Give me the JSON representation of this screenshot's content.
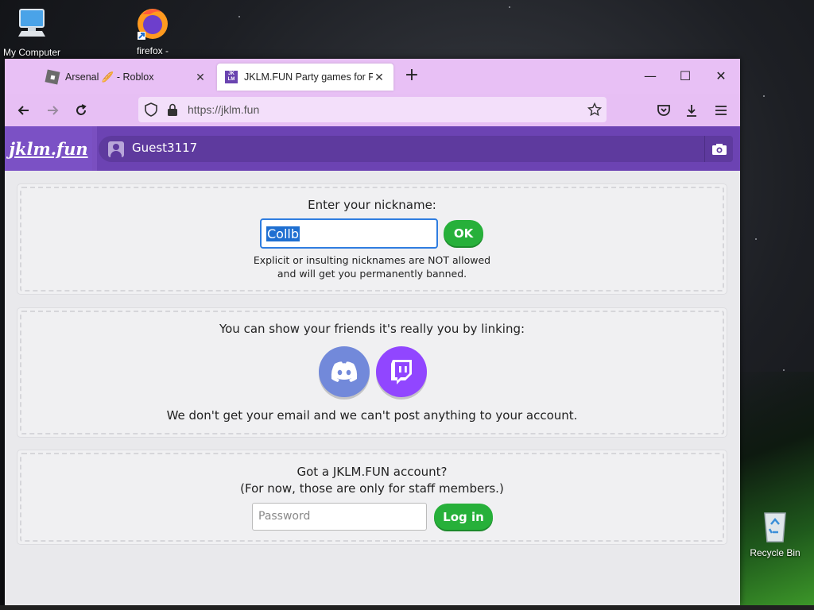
{
  "desktop": {
    "icons": [
      {
        "label": "My Computer"
      },
      {
        "label": "firefox -"
      },
      {
        "label": "Recycle Bin"
      }
    ]
  },
  "browser": {
    "tabs": [
      {
        "title": "Arsenal 🥖 - Roblox",
        "active": false
      },
      {
        "title": "JKLM.FUN Party games for PC &",
        "active": true
      }
    ],
    "url": "https://jklm.fun"
  },
  "site": {
    "logo": "jklm.fun",
    "username": "Guest3117",
    "nickname_panel": {
      "prompt": "Enter your nickname:",
      "value": "Collb",
      "ok_label": "OK",
      "warning_line1": "Explicit or insulting nicknames are NOT allowed",
      "warning_line2": "and will get you permanently banned."
    },
    "link_panel": {
      "prompt": "You can show your friends it's really you by linking:",
      "note": "We don't get your email and we can't post anything to your account."
    },
    "account_panel": {
      "line1": "Got a JKLM.FUN account?",
      "line2": "(For now, those are only for staff members.)",
      "password_placeholder": "Password",
      "login_label": "Log in"
    }
  },
  "colors": {
    "tabbar": "#e8c0f5",
    "header": "#7a4fc0",
    "accent_green": "#27b03a",
    "discord": "#7289da",
    "twitch": "#9146ff"
  }
}
